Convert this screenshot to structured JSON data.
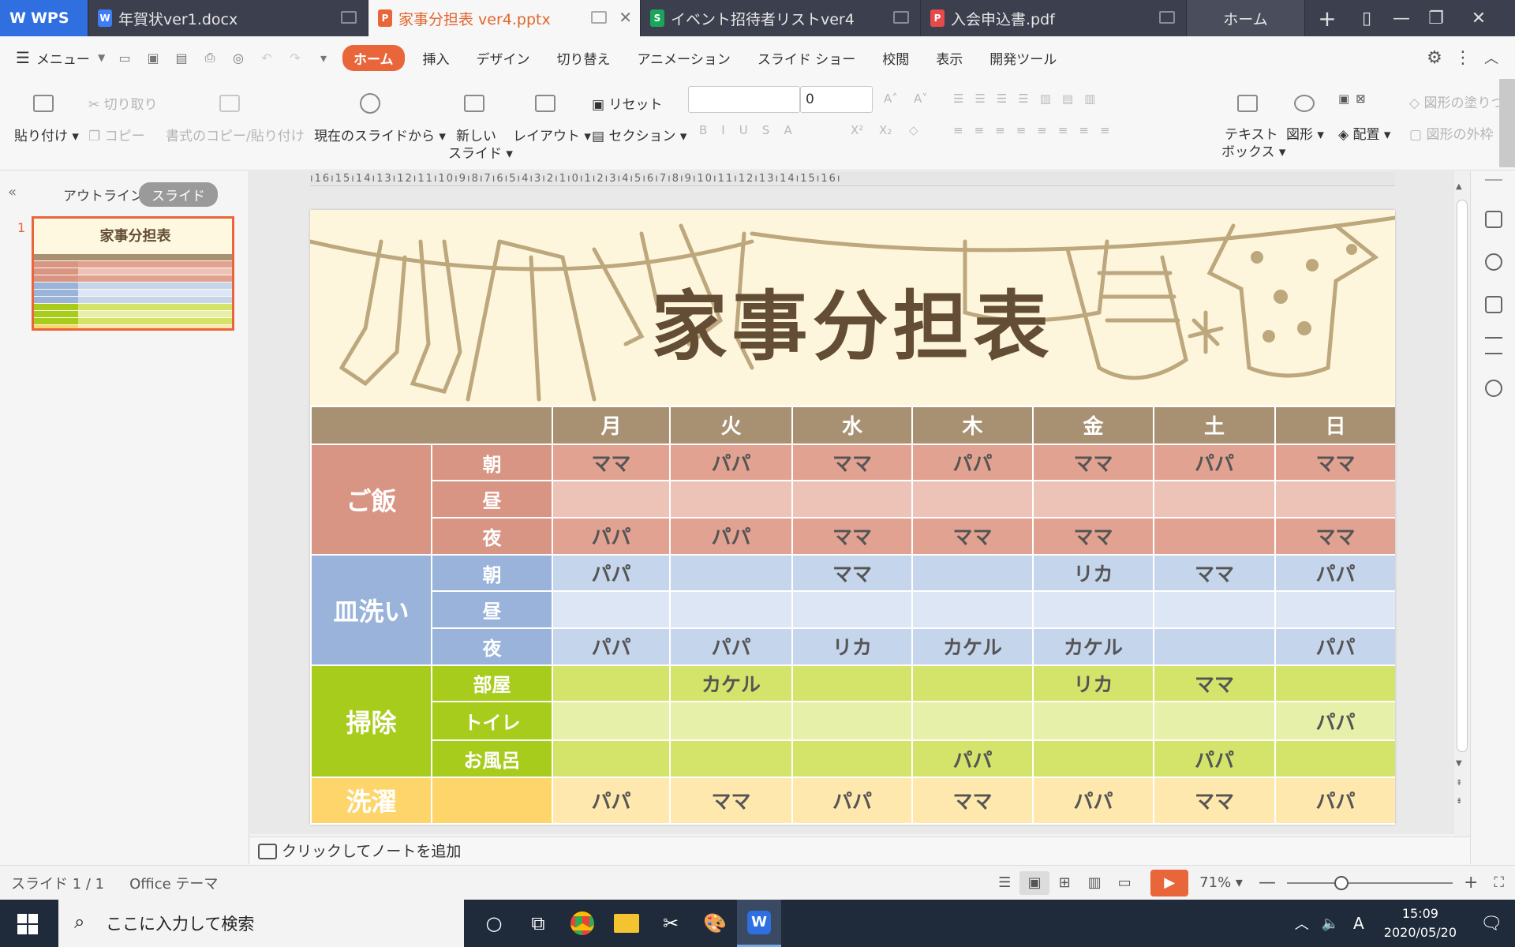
{
  "tabs": [
    {
      "label": "WPS",
      "kind": "app"
    },
    {
      "label": "年賀状ver1.docx",
      "icon": "W",
      "color": "#3e7df6"
    },
    {
      "label": "家事分担表 ver4.pptx",
      "icon": "P",
      "color": "#e8663a",
      "active": true
    },
    {
      "label": "イベント招待者リストver4",
      "icon": "S",
      "color": "#1aa55a"
    },
    {
      "label": "入会申込書.pdf",
      "icon": "P",
      "color": "#e64a4a"
    },
    {
      "label": "ホーム"
    }
  ],
  "menu": {
    "menu_label": "メニュー",
    "items": [
      "ホーム",
      "挿入",
      "デザイン",
      "切り替え",
      "アニメーション",
      "スライド ショー",
      "校閲",
      "表示",
      "開発ツール"
    ]
  },
  "ribbon": {
    "paste": "貼り付け",
    "cut": "切り取り",
    "copy": "コピー",
    "format_copy": "書式のコピー/貼り付け",
    "from_current": "現在のスライドから",
    "new_slide_1": "新しい",
    "new_slide_2": "スライド",
    "layout": "レイアウト",
    "reset": "リセット",
    "section": "セクション",
    "font_size": "0",
    "textbox_1": "テキスト",
    "textbox_2": "ボックス",
    "shape": "図形",
    "arrange": "配置",
    "shape_fill": "図形の塗りつ",
    "shape_outline": "図形の外枠"
  },
  "leftpane": {
    "outline": "アウトライン",
    "slides": "スライド",
    "slide_number": "1"
  },
  "ruler": "ı16ı15ı14ı13ı12ı11ı10ı9ı8ı7ı6ı5ı4ı3ı2ı1ı0ı1ı2ı3ı4ı5ı6ı7ı8ı9ı10ı11ı12ı13ı14ı15ı16ı",
  "slide": {
    "title": "家事分担表",
    "days": [
      "月",
      "火",
      "水",
      "木",
      "金",
      "土",
      "日"
    ],
    "groups": [
      {
        "name": "ご飯",
        "color": "#d99583",
        "rows": [
          {
            "label": "朝",
            "bg": "#e2a292",
            "cells": [
              "ママ",
              "パパ",
              "ママ",
              "パパ",
              "ママ",
              "パパ",
              "ママ"
            ]
          },
          {
            "label": "昼",
            "bg": "#ecc3b6",
            "cells": [
              "",
              "",
              "",
              "",
              "",
              "",
              ""
            ]
          },
          {
            "label": "夜",
            "bg": "#e2a292",
            "cells": [
              "パパ",
              "パパ",
              "ママ",
              "ママ",
              "ママ",
              "",
              "ママ"
            ]
          }
        ]
      },
      {
        "name": "皿洗い",
        "color": "#99b3da",
        "rows": [
          {
            "label": "朝",
            "bg": "#c5d5ec",
            "cells": [
              "パパ",
              "",
              "ママ",
              "",
              "リカ",
              "ママ",
              "パパ"
            ]
          },
          {
            "label": "昼",
            "bg": "#dce6f5",
            "cells": [
              "",
              "",
              "",
              "",
              "",
              "",
              ""
            ]
          },
          {
            "label": "夜",
            "bg": "#c5d5ec",
            "cells": [
              "パパ",
              "パパ",
              "リカ",
              "カケル",
              "カケル",
              "",
              "パパ"
            ]
          }
        ]
      },
      {
        "name": "掃除",
        "color": "#a8cc1c",
        "rows": [
          {
            "label": "部屋",
            "bg": "#d4e46a",
            "cells": [
              "",
              "カケル",
              "",
              "",
              "リカ",
              "ママ",
              ""
            ]
          },
          {
            "label": "トイレ",
            "bg": "#e6f0a8",
            "cells": [
              "",
              "",
              "",
              "",
              "",
              "",
              "パパ"
            ]
          },
          {
            "label": "お風呂",
            "bg": "#d4e46a",
            "cells": [
              "",
              "",
              "",
              "パパ",
              "",
              "パパ",
              ""
            ]
          }
        ]
      },
      {
        "name": "洗濯",
        "color": "#fdd56b",
        "rows": [
          {
            "label": "",
            "bg": "#fee8ae",
            "cells": [
              "パパ",
              "ママ",
              "パパ",
              "ママ",
              "パパ",
              "ママ",
              "パパ"
            ]
          }
        ]
      }
    ]
  },
  "notes": "クリックしてノートを追加",
  "status": {
    "slide_count": "スライド 1 / 1",
    "theme": "Office テーマ",
    "zoom": "71%"
  },
  "taskbar": {
    "search": "ここに入力して検索",
    "time": "15:09",
    "date": "2020/05/20"
  }
}
